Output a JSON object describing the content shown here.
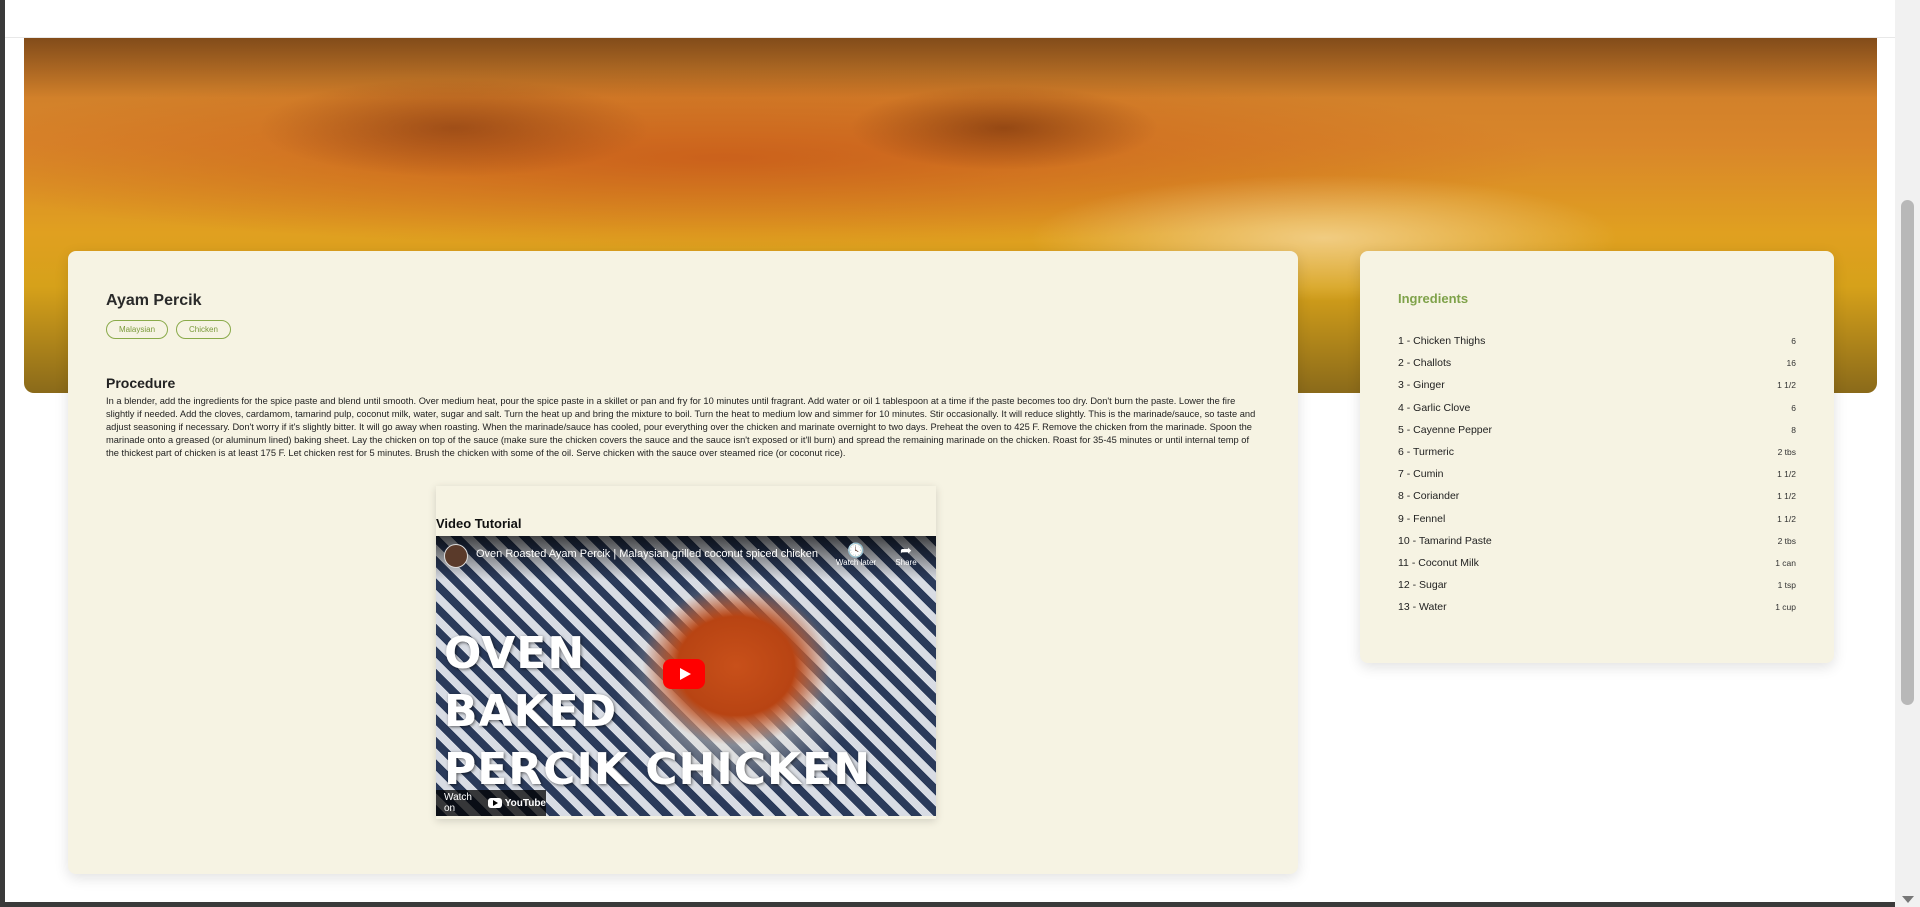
{
  "recipe": {
    "title": "Ayam Percik",
    "tags": [
      "Malaysian",
      "Chicken"
    ],
    "procedure_heading": "Procedure",
    "procedure_text": "In a blender, add the ingredients for the spice paste and blend until smooth. Over medium heat, pour the spice paste in a skillet or pan and fry for 10 minutes until fragrant. Add water or oil 1 tablespoon at a time if the paste becomes too dry. Don't burn the paste. Lower the fire slightly if needed. Add the cloves, cardamom, tamarind pulp, coconut milk, water, sugar and salt. Turn the heat up and bring the mixture to boil. Turn the heat to medium low and simmer for 10 minutes. Stir occasionally. It will reduce slightly. This is the marinade/sauce, so taste and adjust seasoning if necessary. Don't worry if it's slightly bitter. It will go away when roasting. When the marinade/sauce has cooled, pour everything over the chicken and marinate overnight to two days. Preheat the oven to 425 F. Remove the chicken from the marinade. Spoon the marinade onto a greased (or aluminum lined) baking sheet. Lay the chicken on top of the sauce (make sure the chicken covers the sauce and the sauce isn't exposed or it'll burn) and spread the remaining marinade on the chicken. Roast for 35-45 minutes or until internal temp of the thickest part of chicken is at least 175 F. Let chicken rest for 5 minutes. Brush the chicken with some of the oil. Serve chicken with the sauce over steamed rice (or coconut rice)."
  },
  "video": {
    "heading": "Video Tutorial",
    "title": "Oven Roasted Ayam Percik | Malaysian grilled coconut spiced chicken",
    "watch_later": "Watch later",
    "share": "Share",
    "overlay_lines": [
      "OVEN",
      "BAKED",
      "PERCIK CHICKEN"
    ],
    "watch_on": "Watch on",
    "youtube_label": "YouTube"
  },
  "ingredients": {
    "heading": "Ingredients",
    "items": [
      {
        "name": "1 - Chicken Thighs",
        "qty": "6"
      },
      {
        "name": "2 - Challots",
        "qty": "16"
      },
      {
        "name": "3 - Ginger",
        "qty": "1 1/2"
      },
      {
        "name": "4 - Garlic Clove",
        "qty": "6"
      },
      {
        "name": "5 - Cayenne Pepper",
        "qty": "8"
      },
      {
        "name": "6 - Turmeric",
        "qty": "2 tbs"
      },
      {
        "name": "7 - Cumin",
        "qty": "1 1/2"
      },
      {
        "name": "8 - Coriander",
        "qty": "1 1/2"
      },
      {
        "name": "9 - Fennel",
        "qty": "1 1/2"
      },
      {
        "name": "10 - Tamarind Paste",
        "qty": "2 tbs"
      },
      {
        "name": "11 - Coconut Milk",
        "qty": "1 can"
      },
      {
        "name": "12 - Sugar",
        "qty": "1 tsp"
      },
      {
        "name": "13 - Water",
        "qty": "1 cup"
      }
    ]
  },
  "colors": {
    "card_bg": "#f6f3e3",
    "accent_green": "#7fa24a",
    "play_red": "#ff0000"
  }
}
